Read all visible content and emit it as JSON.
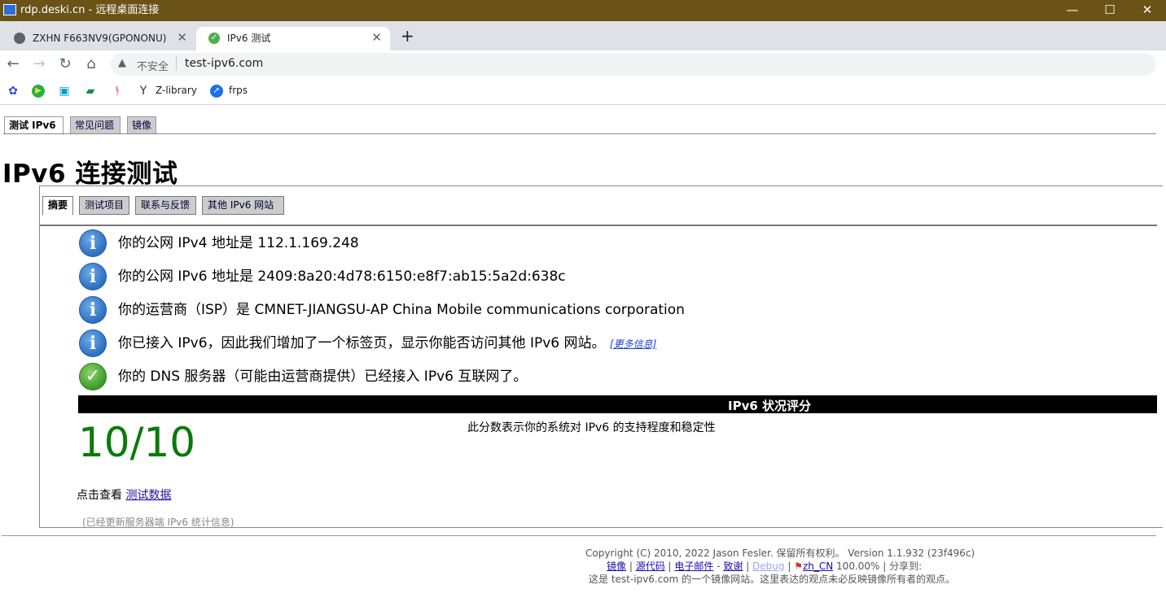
{
  "window": {
    "title": "rdp.deski.cn - 远程桌面连接"
  },
  "browser": {
    "tabs": [
      {
        "label": "ZXHN F663NV9(GPONONU)",
        "close": "✕"
      },
      {
        "label": "IPv6 测试",
        "close": "✕"
      }
    ],
    "new_tab": "+",
    "address": {
      "security_label": "不安全",
      "url": "test-ipv6.com"
    },
    "bookmarks": [
      {
        "label": ""
      },
      {
        "label": ""
      },
      {
        "label": ""
      },
      {
        "label": ""
      },
      {
        "label": ""
      },
      {
        "label": "Z-library"
      },
      {
        "label": "frps"
      }
    ]
  },
  "page": {
    "top_tabs": [
      "测试 IPv6",
      "常见问题",
      "镜像"
    ],
    "title": "IPv6 连接测试",
    "inner_tabs": [
      "摘要",
      "测试项目",
      "联系与反馈",
      "其他 IPv6 网站"
    ],
    "results": [
      {
        "icon": "info",
        "text": "你的公网 IPv4 地址是 112.1.169.248"
      },
      {
        "icon": "info",
        "text": "你的公网 IPv6 地址是 2409:8a20:4d78:6150:e8f7:ab15:5a2d:638c"
      },
      {
        "icon": "info",
        "text": "你的运营商（ISP）是 CMNET-JIANGSU-AP China Mobile communications corporation"
      },
      {
        "icon": "info",
        "text": "你已接入 IPv6，因此我们增加了一个标签页，显示你能否访问其他 IPv6 网站。",
        "link": "[更多信息]"
      },
      {
        "icon": "ok",
        "text": "你的 DNS 服务器（可能由运营商提供）已经接入 IPv6 互联网了。"
      }
    ],
    "score_header": "IPv6 状况评分",
    "score": "10/10",
    "score_desc": "此分数表示你的系统对 IPv6 的支持程度和稳定性",
    "click_prefix": "点击查看",
    "click_link": "测试数据",
    "updated_note": "(已经更新服务器端 IPv6 统计信息)"
  },
  "footer": {
    "copyright": "Copyright (C) 2010, 2022 Jason Fesler. 保留所有权利。 Version 1.1.932 (23f496c)",
    "links": {
      "mirror": "镜像",
      "source": "源代码",
      "email": "电子邮件",
      "dash": " - ",
      "thanks": "致谢",
      "debug": "Debug",
      "locale": "zh_CN",
      "percent": "100.00%",
      "share": "分享到:"
    },
    "notice": "这是 test-ipv6.com 的一个镜像网站。这里表达的观点未必反映镜像所有者的观点。"
  }
}
